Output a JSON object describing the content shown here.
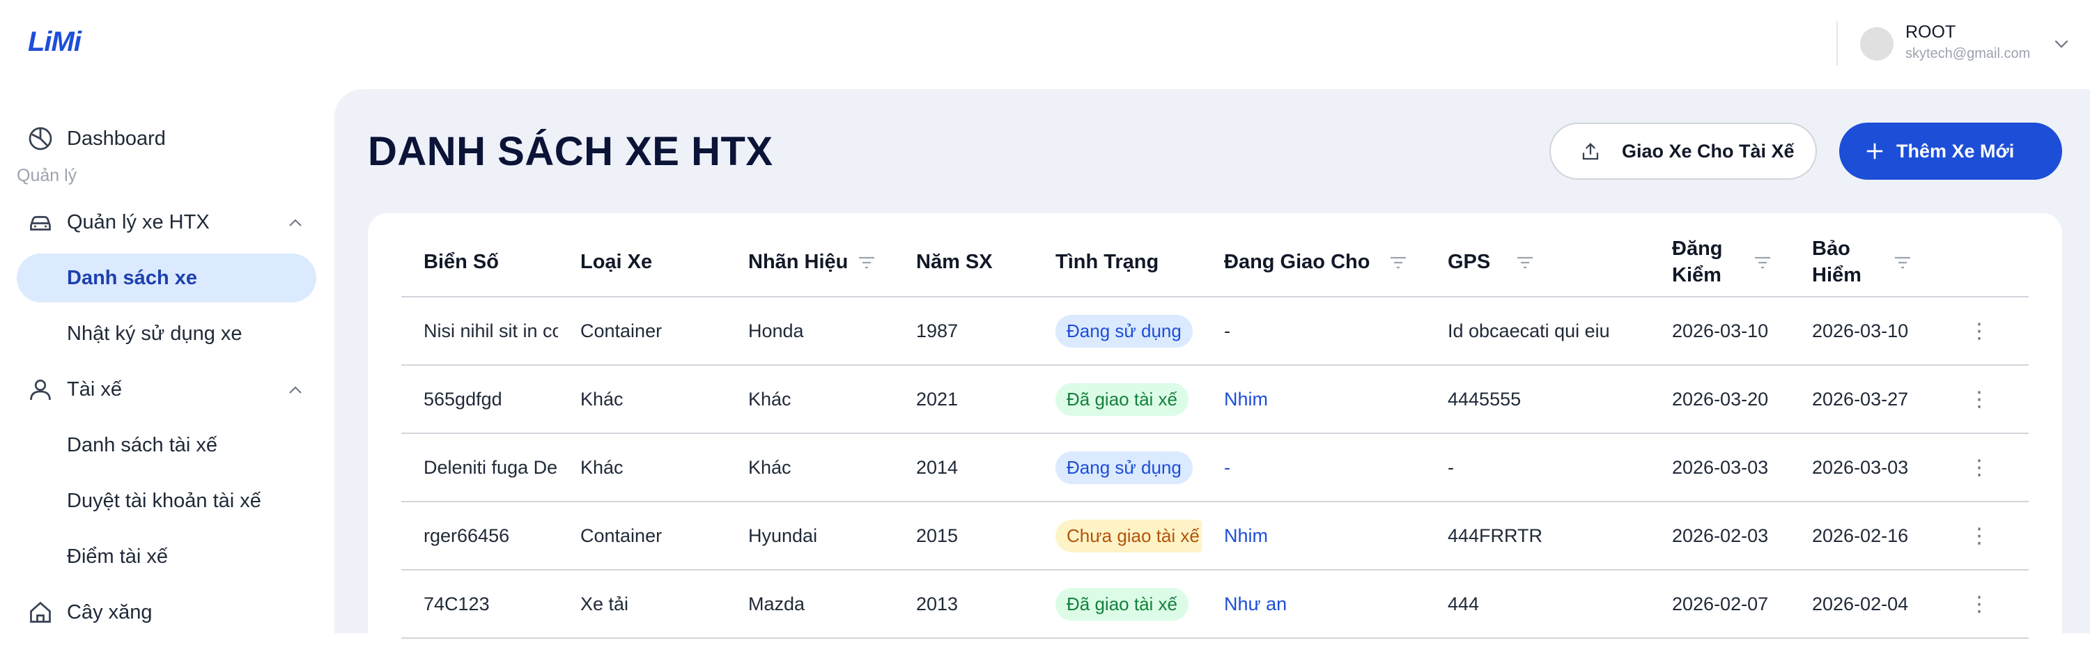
{
  "header": {
    "logo": "LiMi",
    "user_name": "ROOT",
    "user_email": "skytech@gmail.com"
  },
  "sidebar": {
    "dashboard": "Dashboard",
    "section": "Quản lý",
    "vehicle_group": "Quản lý xe HTX",
    "vehicle_list": "Danh sách xe",
    "vehicle_log": "Nhật ký sử dụng xe",
    "driver_group": "Tài xế",
    "driver_list": "Danh sách tài xế",
    "driver_approve": "Duyệt tài khoản tài xế",
    "driver_points": "Điểm tài xế",
    "gas_station": "Cây xăng"
  },
  "page": {
    "title": "DANH SÁCH XE HTX",
    "assign_button": "Giao Xe Cho Tài Xế",
    "add_button": "Thêm Xe Mới"
  },
  "table": {
    "headers": {
      "plate": "Biển Số",
      "type": "Loại Xe",
      "brand": "Nhãn Hiệu",
      "year": "Năm SX",
      "status": "Tình Trạng",
      "assigned": "Đang Giao Cho",
      "gps": "GPS",
      "registration": "Đăng Kiểm",
      "insurance": "Bảo Hiểm"
    },
    "rows": [
      {
        "plate": "Nisi nihil sit in co",
        "type": "Container",
        "brand": "Honda",
        "year": "1987",
        "status": "Đang sử dụng",
        "assigned": "-",
        "gps": "Id obcaecati qui eiu",
        "registration": "2026-03-10",
        "insurance": "2026-03-10"
      },
      {
        "plate": "565gdfgd",
        "type": "Khác",
        "brand": "Khác",
        "year": "2021",
        "status": "Đã giao tài xế",
        "assigned": "Nhim",
        "gps": "4445555",
        "registration": "2026-03-20",
        "insurance": "2026-03-27"
      },
      {
        "plate": "Deleniti fuga Dele",
        "type": "Khác",
        "brand": "Khác",
        "year": "2014",
        "status": "Đang sử dụng",
        "assigned": "-",
        "gps": "-",
        "registration": "2026-03-03",
        "insurance": "2026-03-03"
      },
      {
        "plate": "rger66456",
        "type": "Container",
        "brand": "Hyundai",
        "year": "2015",
        "status": "Chưa giao tài xế",
        "assigned": "Nhim",
        "gps": "444FRRTR",
        "registration": "2026-02-03",
        "insurance": "2026-02-16"
      },
      {
        "plate": "74C123",
        "type": "Xe tải",
        "brand": "Mazda",
        "year": "2013",
        "status": "Đã giao tài xế",
        "assigned": "Như an",
        "gps": "444",
        "registration": "2026-02-07",
        "insurance": "2026-02-04"
      }
    ],
    "more_glyph": "⋮"
  },
  "colors": {
    "primary": "#1d4ed8",
    "main_bg": "#eef1f8",
    "active_nav_bg": "#dbeafe"
  }
}
